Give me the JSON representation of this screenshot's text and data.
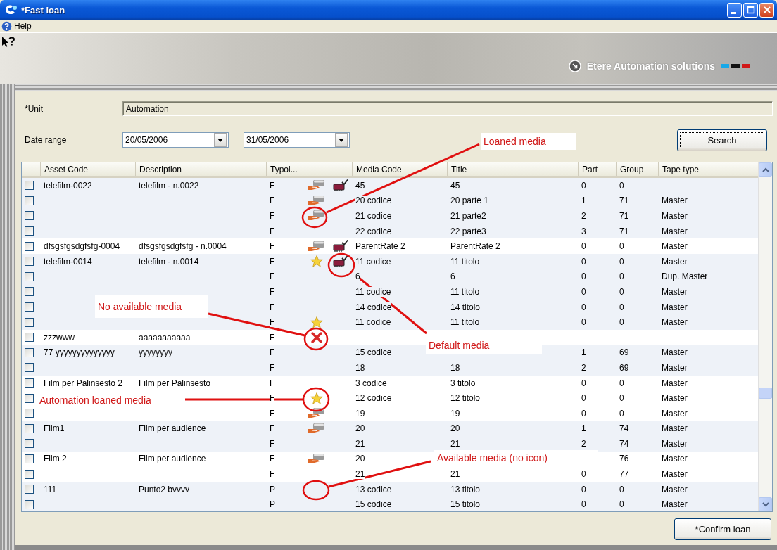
{
  "window": {
    "title": "*Fast loan"
  },
  "menu": [
    "Help"
  ],
  "banner": {
    "brand": "Etere Automation solutions"
  },
  "form": {
    "unit_label": "*Unit",
    "unit_value": "Automation",
    "date_label": "Date range",
    "date_from": "20/05/2006",
    "date_to": "31/05/2006",
    "search_button": "Search"
  },
  "table": {
    "columns": [
      "Asset Code",
      "Description",
      "Typol...",
      "Media Code",
      "Title",
      "Part",
      "Group",
      "Tape type"
    ],
    "assets": [
      {
        "asset_code": "telefilm-0022",
        "description": "telefilm - n.0022",
        "media": [
          {
            "checked": false,
            "typology": "F",
            "kind": "loaned",
            "default": true,
            "media_code": "45",
            "title": "45",
            "part": "0",
            "group": "0"
          },
          {
            "checked": false,
            "typology": "F",
            "kind": "loaned",
            "default": false,
            "media_code": "20 codice",
            "title": "20 parte 1",
            "part": "1",
            "group": "71",
            "tape_type": "Master"
          },
          {
            "checked": false,
            "typology": "F",
            "kind": "loaned",
            "default": false,
            "media_code": "21 codice",
            "title": "21 parte2",
            "part": "2",
            "group": "71",
            "tape_type": "Master"
          },
          {
            "checked": false,
            "typology": "F",
            "kind": "available",
            "default": false,
            "media_code": "22 codice",
            "title": "22 parte3",
            "part": "3",
            "group": "71",
            "tape_type": "Master"
          }
        ]
      },
      {
        "asset_code": "dfsgsfgsdgfsfg-0004",
        "description": "dfsgsfgsdgfsfg - n.0004",
        "media": [
          {
            "checked": false,
            "typology": "F",
            "kind": "loaned",
            "default": true,
            "media_code": "ParentRate 2",
            "title": "ParentRate 2",
            "part": "0",
            "group": "0",
            "tape_type": "Master"
          }
        ]
      },
      {
        "asset_code": "telefilm-0014",
        "description": "telefilm - n.0014",
        "media": [
          {
            "checked": false,
            "typology": "F",
            "kind": "automation",
            "default": true,
            "media_code": "11 codice",
            "title": "11 titolo",
            "part": "0",
            "group": "0",
            "tape_type": "Master"
          },
          {
            "checked": false,
            "typology": "F",
            "kind": "available",
            "default": false,
            "media_code": "6",
            "title": "6",
            "part": "0",
            "group": "0",
            "tape_type": "Dup. Master"
          },
          {
            "checked": false,
            "typology": "F",
            "kind": "available",
            "default": false,
            "media_code": "11 codice",
            "title": "11 titolo",
            "part": "0",
            "group": "0",
            "tape_type": "Master"
          },
          {
            "checked": false,
            "typology": "F",
            "kind": "available",
            "default": false,
            "media_code": "14 codice",
            "title": "14 titolo",
            "part": "0",
            "group": "0",
            "tape_type": "Master"
          },
          {
            "checked": false,
            "typology": "F",
            "kind": "automation",
            "default": false,
            "media_code": "11 codice",
            "title": "11 titolo",
            "part": "0",
            "group": "0",
            "tape_type": "Master"
          }
        ]
      },
      {
        "asset_code": "zzzwww",
        "description": "aaaaaaaaaaa",
        "media": [
          {
            "checked": false,
            "typology": "F",
            "kind": "unavailable",
            "default": false
          }
        ]
      },
      {
        "asset_code": "77 yyyyyyyyyyyyyy",
        "description": "yyyyyyyy",
        "media": [
          {
            "checked": false,
            "typology": "F",
            "kind": "available",
            "default": false,
            "media_code": "15 codice",
            "part": "1",
            "group": "69",
            "tape_type": "Master"
          },
          {
            "checked": false,
            "typology": "F",
            "kind": "available",
            "default": false,
            "media_code": "18",
            "title": "18",
            "part": "2",
            "group": "69",
            "tape_type": "Master"
          }
        ]
      },
      {
        "asset_code": "Film per Palinsesto 2",
        "description": "Film per Palinsesto",
        "media": [
          {
            "checked": false,
            "typology": "F",
            "kind": "available",
            "default": false,
            "media_code": "3 codice",
            "title": "3 titolo",
            "part": "0",
            "group": "0",
            "tape_type": "Master"
          },
          {
            "checked": false,
            "typology": "F",
            "kind": "automation",
            "default": false,
            "media_code": "12 codice",
            "title": "12 titolo",
            "part": "0",
            "group": "0",
            "tape_type": "Master"
          },
          {
            "checked": false,
            "typology": "F",
            "kind": "loaned",
            "default": false,
            "media_code": "19",
            "title": "19",
            "part": "0",
            "group": "0",
            "tape_type": "Master"
          }
        ]
      },
      {
        "asset_code": "Film1",
        "description": "Film per audience",
        "media": [
          {
            "checked": false,
            "typology": "F",
            "kind": "loaned",
            "default": false,
            "media_code": "20",
            "title": "20",
            "part": "1",
            "group": "74",
            "tape_type": "Master"
          },
          {
            "checked": false,
            "typology": "F",
            "kind": "available",
            "default": false,
            "media_code": "21",
            "title": "21",
            "part": "2",
            "group": "74",
            "tape_type": "Master"
          }
        ]
      },
      {
        "asset_code": "Film 2",
        "description": "Film per audience",
        "media": [
          {
            "checked": false,
            "typology": "F",
            "kind": "loaned",
            "default": false,
            "media_code": "20",
            "group": "76",
            "tape_type": "Master"
          },
          {
            "checked": false,
            "typology": "F",
            "kind": "available",
            "default": false,
            "media_code": "21",
            "title": "21",
            "part": "0",
            "group": "77",
            "tape_type": "Master"
          }
        ]
      },
      {
        "asset_code": "111",
        "description": "Punto2   bvvvv",
        "media": [
          {
            "checked": false,
            "typology": "P",
            "kind": "available",
            "default": false,
            "media_code": "13 codice",
            "title": "13 titolo",
            "part": "0",
            "group": "0",
            "tape_type": "Master"
          },
          {
            "checked": false,
            "typology": "P",
            "kind": "available",
            "default": false,
            "media_code": "15 codice",
            "title": "15 titolo",
            "part": "0",
            "group": "0",
            "tape_type": "Master"
          }
        ]
      }
    ]
  },
  "confirm_button": "*Confirm loan",
  "annotations": [
    "Loaned media",
    "No available media",
    "Default media",
    "Automation loaned media",
    "Available media (no icon)"
  ]
}
